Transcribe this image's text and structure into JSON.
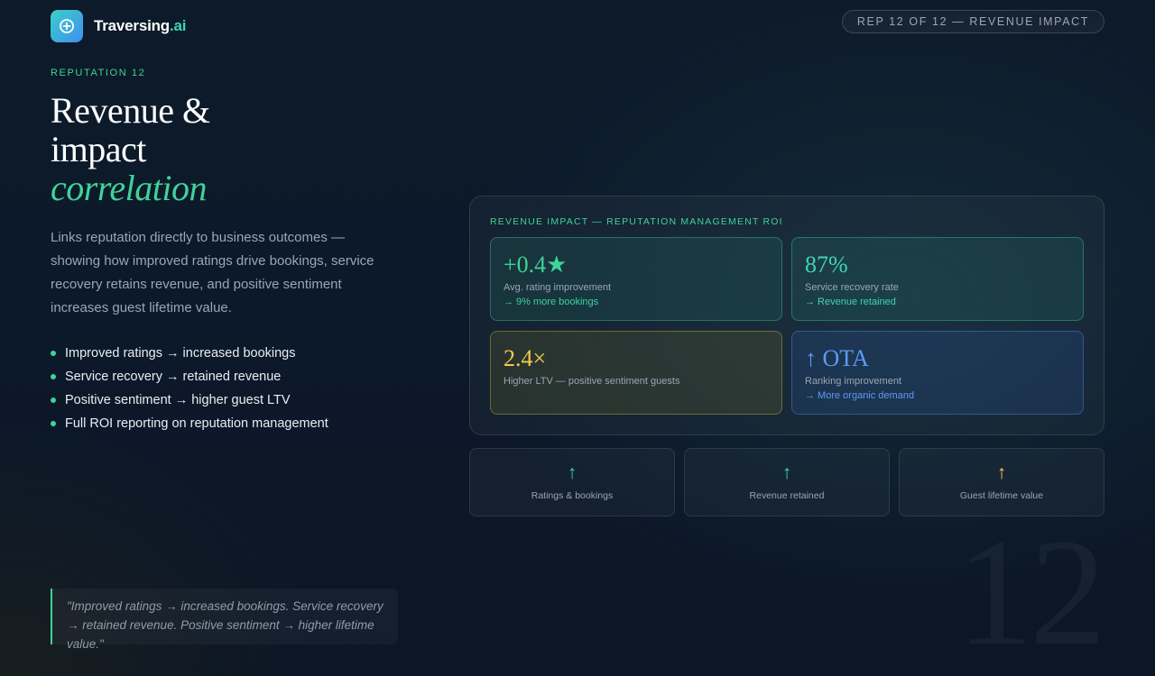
{
  "brand": {
    "name_main": "Traversing",
    "name_suffix": ".ai",
    "logo_icon": "plus-circle-icon",
    "accent_color": "#3fd398"
  },
  "header": {
    "slide_indicator": "REP 12 OF 12 — REVENUE IMPACT"
  },
  "hero": {
    "eyebrow": "REPUTATION 12",
    "title_line1": "Revenue &",
    "title_line2": "impact",
    "title_line3": "correlation",
    "description": "Links reputation directly to business outcomes — showing how improved ratings drive bookings, service recovery retains revenue, and positive sentiment increases guest lifetime value."
  },
  "bullets": [
    "Improved ratings → increased bookings",
    "Service recovery → retained revenue",
    "Positive sentiment → higher guest LTV",
    "Full ROI reporting on reputation management"
  ],
  "quote": "\"Improved ratings → increased bookings. Service recovery → retained revenue. Positive sentiment → higher lifetime value.\"",
  "panel": {
    "title": "REVENUE IMPACT — REPUTATION MANAGEMENT ROI",
    "cards": [
      {
        "value": "+0.4★",
        "label": "Avg. rating improvement",
        "sub": "→ 9% more bookings",
        "color": "#3fd398"
      },
      {
        "value": "87%",
        "label": "Service recovery rate",
        "sub": "→ Revenue retained",
        "color": "#3fd3b6"
      },
      {
        "value": "2.4×",
        "label": "Higher LTV — positive sentiment guests",
        "sub": "",
        "color": "#f2c94c"
      },
      {
        "value": "↑ OTA",
        "label": "Ranking improvement",
        "sub": "→ More organic demand",
        "color": "#5b9bf5"
      }
    ]
  },
  "mini_cards": [
    {
      "arrow": "↑",
      "label": "Ratings & bookings",
      "icon": "up-arrow-icon"
    },
    {
      "arrow": "↑",
      "label": "Revenue retained",
      "icon": "up-arrow-icon"
    },
    {
      "arrow": "↑",
      "label": "Guest lifetime value",
      "icon": "up-arrow-icon"
    }
  ],
  "watermark": "12"
}
